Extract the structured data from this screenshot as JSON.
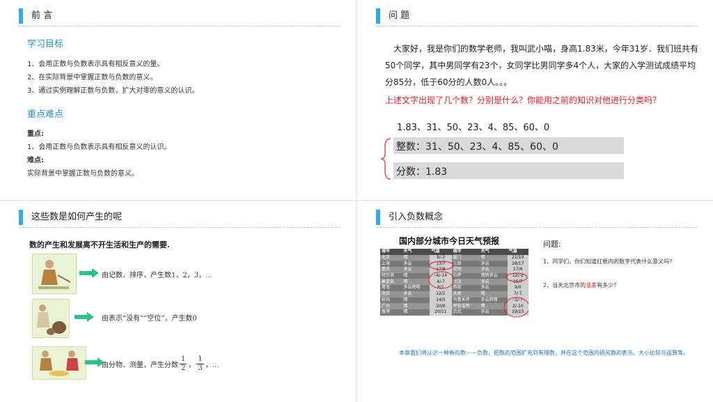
{
  "slide1": {
    "title": "前 言",
    "goals_heading": "学习目标",
    "goals": [
      "1、会用正数与负数表示具有相反意义的量。",
      "2、在实际背景中掌握正数与负数的意义。",
      "3、通过实例理解正数与负数，扩大对零的意义的认识。"
    ],
    "focus_heading": "重点难点",
    "key_label": "重点:",
    "key_text": "1、会用正数与负数表示具有相反意义的认识。",
    "difficulty_label": "难点:",
    "difficulty_text": "实际背景中掌握正数与负数的意义。"
  },
  "slide2": {
    "title": "问 题",
    "paragraph": "大家好，我是你们的数学老师，我叫武小喵，身高1.83米，今年31岁．我们班共有50个同学，其中男同学有23个，女同学比男同学多4个人，大家的入学测试成绩平均分85分，低于60分的人数0人。。。",
    "question": "上述文字出现了几个数？分别是什么？你能用之前的知识对他进行分类吗？",
    "numbers": "1.83、31、50、23、4、85、60、0",
    "integers": "整数：31、50、23、4、85、60、0",
    "fractions": "分数：1.83"
  },
  "slide3": {
    "title": "这些数是如何产生的呢",
    "intro": "数的产生和发展离不开生活和生产的需要.",
    "row1": "由记数、排序，产生数1，2，3，…",
    "row2": "由表示“没有”“空位”，产生数0",
    "row3_prefix": "由分物、测量，产生分数",
    "frac1_num": "1",
    "frac1_den": "2",
    "frac_sep": "，",
    "frac2_num": "1",
    "frac2_den": "3",
    "row3_suffix": "，…"
  },
  "slide4": {
    "title": "引入负数概念",
    "table_title": "国内部分城市今日天气预报",
    "table_headers": [
      "城市",
      "天气",
      "气温",
      "城市",
      "天气",
      "气温"
    ],
    "table_rows": [
      [
        "北京",
        "晴",
        "9/-3",
        "厦门",
        "晴",
        "21/10"
      ],
      [
        "上海",
        "多云",
        "13/7",
        "三亚",
        "多云",
        "28/17"
      ],
      [
        "重庆",
        "多云",
        "17/9",
        "昆明",
        "多云",
        "17/6"
      ],
      [
        "哈尔滨",
        "晴",
        "-4/-14",
        "拉萨",
        "晴转多云",
        "12/-5"
      ],
      [
        "秦皇岛",
        "晴",
        "4/-7",
        "武汉",
        "多云",
        "15/7"
      ],
      [
        "青岛",
        "多云转晴",
        "8/1",
        "西安",
        "多云",
        "9/0"
      ],
      [
        "南京",
        "多云",
        "12/1",
        "太原",
        "晴",
        "7/-7"
      ],
      [
        "杭州",
        "晴",
        "14/5",
        "乌鲁木齐",
        "多云转晴",
        "-1/-7"
      ],
      [
        "广州",
        "晴",
        "20/6",
        "呼和浩特",
        "晴",
        "2/-10"
      ],
      [
        "香港",
        "晴",
        "20/11",
        "台北",
        "多云",
        "19/15"
      ]
    ],
    "question_heading": "问题:",
    "q1": "1、同学们，你们知道红框内的数字代表什么意义吗?",
    "q2_prefix": "2、当天北京市的",
    "q2_highlight": "温差",
    "q2_suffix": "有多少?",
    "summary": "本章我们将认识一种新的数——负数，把数的范围扩充到有理数，并在这个范围内研究数的表示、大小比较与运算等。"
  }
}
